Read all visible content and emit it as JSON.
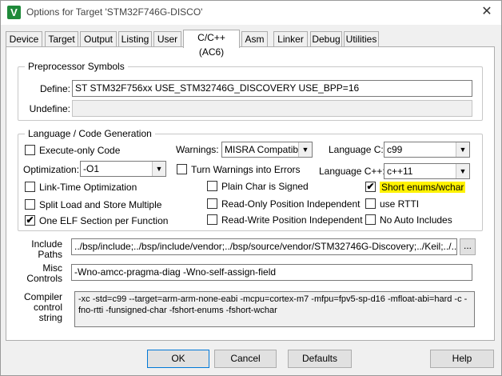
{
  "window": {
    "title": "Options for Target 'STM32F746G-DISCO'",
    "app_icon_letter": "V",
    "close_glyph": "✕"
  },
  "tabs": [
    {
      "label": "Device"
    },
    {
      "label": "Target"
    },
    {
      "label": "Output"
    },
    {
      "label": "Listing"
    },
    {
      "label": "User"
    },
    {
      "label": "C/C++ (AC6)"
    },
    {
      "label": "Asm"
    },
    {
      "label": "Linker"
    },
    {
      "label": "Debug"
    },
    {
      "label": "Utilities"
    }
  ],
  "active_tab": "C/C++ (AC6)",
  "preprocessor": {
    "legend": "Preprocessor Symbols",
    "define_label": "Define:",
    "define_value": "ST STM32F756xx USE_STM32746G_DISCOVERY USE_BPP=16",
    "undefine_label": "Undefine:",
    "undefine_value": ""
  },
  "language": {
    "legend": "Language / Code Generation",
    "execute_only": {
      "label": "Execute-only Code",
      "checked": false
    },
    "warnings_label": "Warnings:",
    "warnings_value": "MISRA Compatible",
    "language_c_label": "Language C:",
    "language_c_value": "c99",
    "optimization_label": "Optimization:",
    "optimization_value": "-O1",
    "turn_warnings": {
      "label": "Turn Warnings into Errors",
      "checked": false
    },
    "language_cpp_label": "Language C++:",
    "language_cpp_value": "c++11",
    "link_time": {
      "label": "Link-Time Optimization",
      "checked": false
    },
    "plain_char": {
      "label": "Plain Char is Signed",
      "checked": false
    },
    "short_enums": {
      "label": "Short enums/wchar",
      "checked": true
    },
    "split_load": {
      "label": "Split Load and Store Multiple",
      "checked": false
    },
    "ropi": {
      "label": "Read-Only Position Independent",
      "checked": false
    },
    "use_rtti": {
      "label": "use RTTI",
      "checked": false
    },
    "one_elf": {
      "label": "One ELF Section per Function",
      "checked": true
    },
    "rwpi": {
      "label": "Read-Write Position Independent",
      "checked": false
    },
    "no_auto_includes": {
      "label": "No Auto Includes",
      "checked": false
    }
  },
  "include_paths": {
    "label_line1": "Include",
    "label_line2": "Paths",
    "value": "../bsp/include;../bsp/include/vendor;../bsp/source/vendor/STM32746G-Discovery;../Keil;../../touch",
    "browse_label": "..."
  },
  "misc_controls": {
    "label_line1": "Misc",
    "label_line2": "Controls",
    "value": "-Wno-amcc-pragma-diag -Wno-self-assign-field"
  },
  "compiler_string": {
    "label_line1": "Compiler",
    "label_line2": "control",
    "label_line3": "string",
    "value": "-xc -std=c99 --target=arm-arm-none-eabi -mcpu=cortex-m7 -mfpu=fpv5-sp-d16 -mfloat-abi=hard -c -fno-rtti -funsigned-char -fshort-enums -fshort-wchar"
  },
  "buttons": {
    "ok": "OK",
    "cancel": "Cancel",
    "defaults": "Defaults",
    "help": "Help"
  },
  "glyphs": {
    "check": "✔",
    "dropdown": "▼"
  },
  "colors": {
    "highlight": "#fff200",
    "default_button_border": "#0078d7"
  }
}
